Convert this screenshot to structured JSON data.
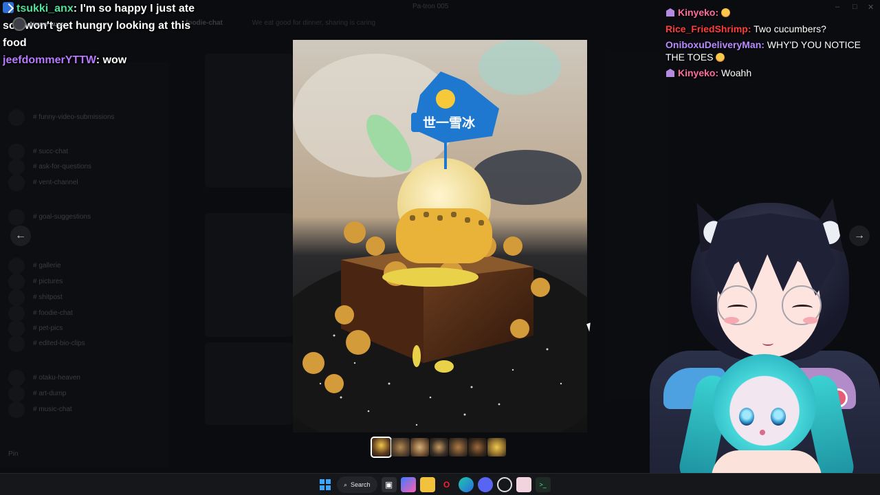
{
  "background": {
    "window_title": "Pa-tron 005",
    "header_channel": "foodie-chat",
    "header_topic": "We eat good for dinner, sharing is caring",
    "aimme_name": "Aimme",
    "aimme_status": "succ",
    "channels": [
      "funny-video-submissions",
      "succ-chat",
      "ask-for-questions",
      "vent-channel",
      "goal-suggestions",
      "gallerie",
      "pictures",
      "shitpost",
      "foodie-chat",
      "pet-pics",
      "edited-bio-clips",
      "otaku-heaven",
      "art-dump",
      "music-chat"
    ],
    "bottom_user": "Pin"
  },
  "overlay_chat": [
    {
      "user": "tsukki_anx",
      "user_color": "#4fe39a",
      "text": ": I'm so happy I just ate so I won't get hungry looking at this food"
    },
    {
      "user": "jeefdommerYTTW",
      "user_color": "#b779ff",
      "text": ": wow"
    }
  ],
  "right_chat": [
    {
      "user": "Kinyeko:",
      "user_color": "#ff6b9a",
      "text": "",
      "emoji": true,
      "badge": true
    },
    {
      "user": "Rice_FriedShrimp:",
      "user_color": "#ff3c3c",
      "text": "Two cucumbers?",
      "emoji": false,
      "badge": false
    },
    {
      "user": "OniboxuDeliveryMan:",
      "user_color": "#b98bff",
      "text": "WHY'D YOU NOTICE THE TOES",
      "emoji": true,
      "badge": false
    },
    {
      "user": "Kinyeko:",
      "user_color": "#ff6b9a",
      "text": "Woahh",
      "emoji": false,
      "badge": true
    }
  ],
  "lightbox": {
    "prev_label": "←",
    "next_label": "→",
    "sign_text": "世一雪冰",
    "thumbnail_count": 7,
    "active_thumbnail": 1
  },
  "taskbar": {
    "search_label": "Search",
    "icons": [
      "start-icon",
      "search",
      "task-view-icon",
      "copilot-icon",
      "file-explorer-icon",
      "opera-icon",
      "edge-icon",
      "discord-icon",
      "obs-icon",
      "app-icon",
      "terminal-icon"
    ]
  },
  "colors": {
    "discord_bg": "#0b0c0f",
    "taskbar_bg": "#16171b",
    "accent_blue": "#3ea6ff"
  }
}
